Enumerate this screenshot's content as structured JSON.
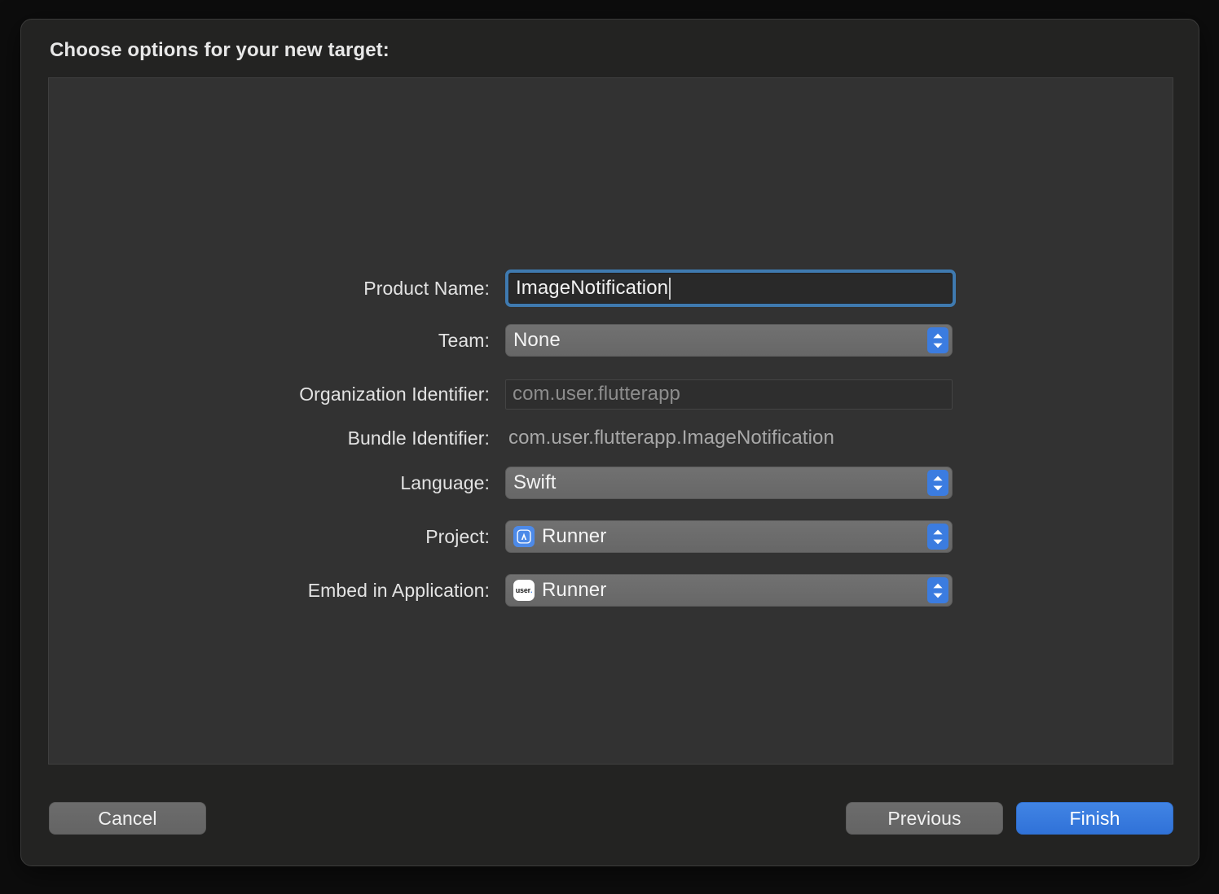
{
  "dialog": {
    "title": "Choose options for your new target:"
  },
  "form": {
    "rows": [
      {
        "label": "Product Name:",
        "control": "textfield-focused",
        "value": "ImageNotification"
      },
      {
        "label": "Team:",
        "control": "popup",
        "value": "None"
      },
      {
        "label": "Organization Identifier:",
        "control": "textfield",
        "value": "",
        "placeholder": "com.user.flutterapp"
      },
      {
        "label": "Bundle Identifier:",
        "control": "static",
        "value": "com.user.flutterapp.ImageNotification"
      },
      {
        "label": "Language:",
        "control": "popup",
        "value": "Swift"
      },
      {
        "label": "Project:",
        "control": "popup",
        "value": "Runner",
        "icon": "xcode-project-icon"
      },
      {
        "label": "Embed in Application:",
        "control": "popup",
        "value": "Runner",
        "icon": "runner-app-icon",
        "icon_text": "user",
        "icon_dot": "."
      }
    ]
  },
  "footer": {
    "cancel_label": "Cancel",
    "previous_label": "Previous",
    "finish_label": "Finish"
  },
  "colors": {
    "accent_blue": "#3b7ce0",
    "focus_ring": "#3f7ab0",
    "panel_bg": "#323232",
    "dialog_bg": "#232322"
  }
}
